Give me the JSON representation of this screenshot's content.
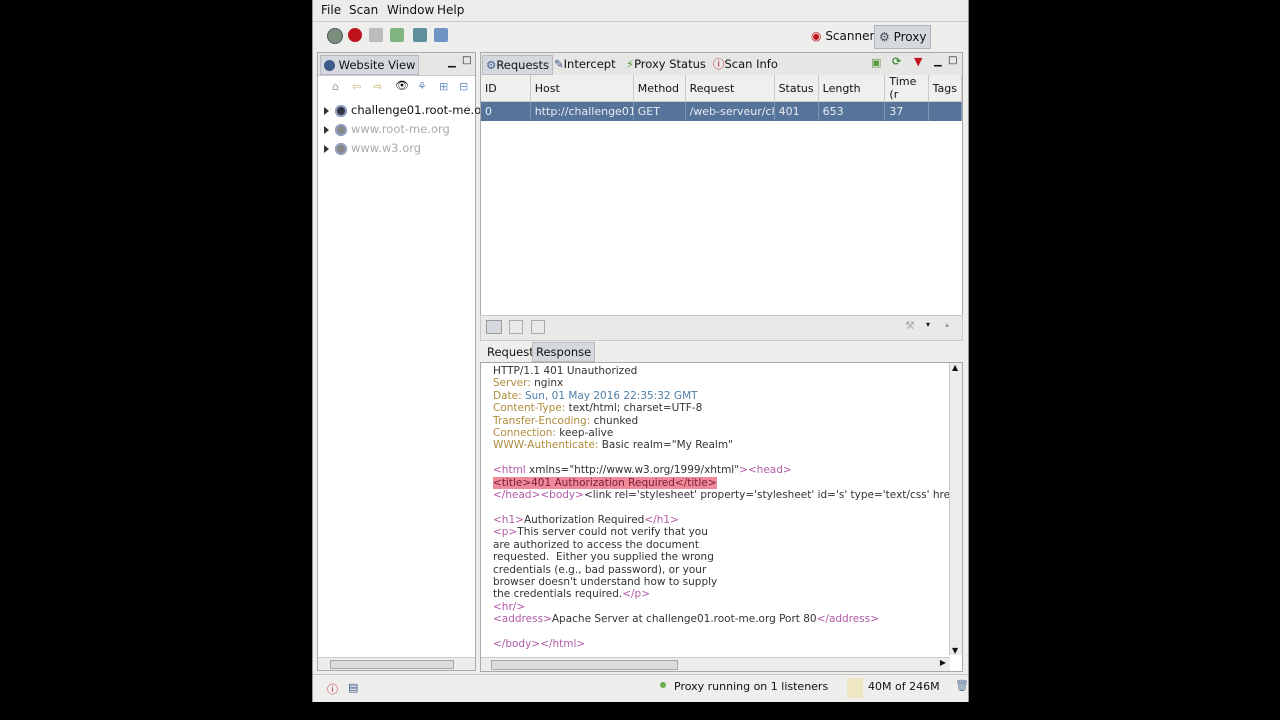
{
  "menu": {
    "file": "File",
    "scan": "Scan",
    "window": "Window",
    "help": "Help"
  },
  "perspectives": {
    "scanner": "Scanner",
    "proxy": "Proxy"
  },
  "website_view": {
    "title": "Website View",
    "items": [
      {
        "label": "challenge01.root-me.or",
        "active": true
      },
      {
        "label": "www.root-me.org",
        "active": false
      },
      {
        "label": "www.w3.org",
        "active": false
      }
    ]
  },
  "tabs": {
    "requests": "Requests",
    "intercept": "Intercept",
    "proxy_status": "Proxy Status",
    "scan_info": "Scan Info"
  },
  "table": {
    "headers": [
      "ID",
      "Host",
      "Method",
      "Request",
      "Status",
      "Length",
      "Time (r",
      "Tags"
    ],
    "rows": [
      [
        "0",
        "http://challenge01",
        "GET",
        "/web-serveur/ch",
        "401",
        "653",
        "37",
        ""
      ]
    ]
  },
  "detail_tabs": {
    "request": "Request",
    "response": "Response"
  },
  "response": {
    "status_line": "HTTP/1.1 401 Unauthorized",
    "headers": [
      {
        "name": "Server:",
        "value": "nginx"
      },
      {
        "name": "Date:",
        "value": "Sun, 01 May 2016 22:35:32 GMT"
      },
      {
        "name": "Content-Type:",
        "value": "text/html; charset=UTF-8"
      },
      {
        "name": "Transfer-Encoding:",
        "value": "chunked"
      },
      {
        "name": "Connection:",
        "value": "keep-alive"
      },
      {
        "name": "WWW-Authenticate:",
        "value": "Basic realm=\"My Realm\""
      }
    ],
    "body_lines": [
      "<html xmlns=\"http://www.w3.org/1999/xhtml\"><head>",
      "<title>401 Authorization Required</title>",
      "</head><body><link rel='stylesheet' property='stylesheet' id='s' type='text/css' hre",
      "",
      "<h1>Authorization Required</h1>",
      "<p>This server could not verify that you",
      "are authorized to access the document",
      "requested.  Either you supplied the wrong",
      "credentials (e.g., bad password), or your",
      "browser doesn't understand how to supply",
      "the credentials required.</p>",
      "<hr/>",
      "<address>Apache Server at challenge01.root-me.org Port 80</address>",
      "",
      "</body></html>"
    ]
  },
  "status": {
    "proxy": "Proxy running on 1 listeners",
    "memory": "40M of 246M"
  },
  "colors": {
    "selection": "#56749a",
    "highlight": "#f08a9a",
    "tag": "#b35aa6"
  }
}
